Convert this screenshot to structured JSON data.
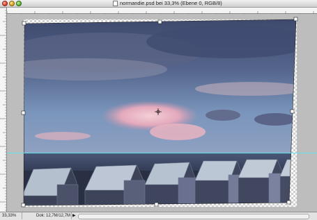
{
  "window": {
    "title": "normandie.psd bei 33,3% (Ebene 0, RGB/8)"
  },
  "status": {
    "zoom": "33,33%",
    "doc_info": "Dok: 12,7M/12,7M",
    "menu_arrow": "▶"
  },
  "colors": {
    "guide": "#5fe3ee",
    "sky_top": "#3d4a6e",
    "sky_mid": "#6f8fb6",
    "cloud_pink": "#e8b9c6",
    "sea": "#3a4560",
    "roof": "#b9c4d2"
  }
}
